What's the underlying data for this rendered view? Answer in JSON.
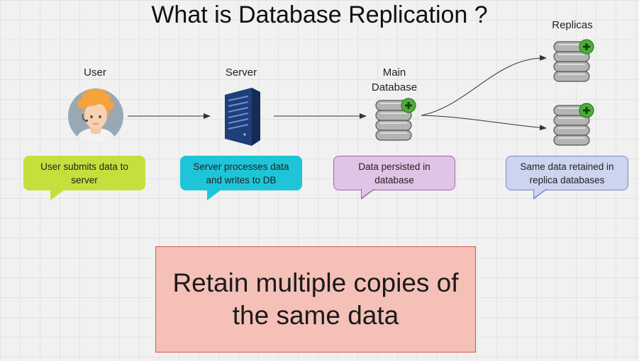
{
  "title": "What is Database Replication ?",
  "nodes": {
    "user": {
      "label": "User"
    },
    "server": {
      "label": "Server"
    },
    "main_db": {
      "label_line1": "Main",
      "label_line2": "Database"
    },
    "replicas": {
      "label": "Replicas"
    }
  },
  "bubbles": [
    {
      "line1": "User submits data to",
      "line2": "server"
    },
    {
      "line1": "Server processes data",
      "line2": "and writes to DB"
    },
    {
      "line1": "Data persisted in",
      "line2": "database"
    },
    {
      "line1": "Same data retained in",
      "line2": "replica databases"
    }
  ],
  "callout": {
    "line1": "Retain multiple copies of",
    "line2": "the same data"
  },
  "colors": {
    "bubble_user": "#c5e03c",
    "bubble_server": "#1ec5d8",
    "bubble_database": "#e0c4e5",
    "bubble_replicas": "#ccd4f0",
    "callout_fill": "#f4c0b8",
    "callout_border": "#d9574a",
    "server_body": "#1e3f7a",
    "db_plus_badge": "#4caf3a"
  },
  "icons": [
    "user-avatar-icon",
    "server-icon",
    "database-icon",
    "plus-badge-icon"
  ]
}
